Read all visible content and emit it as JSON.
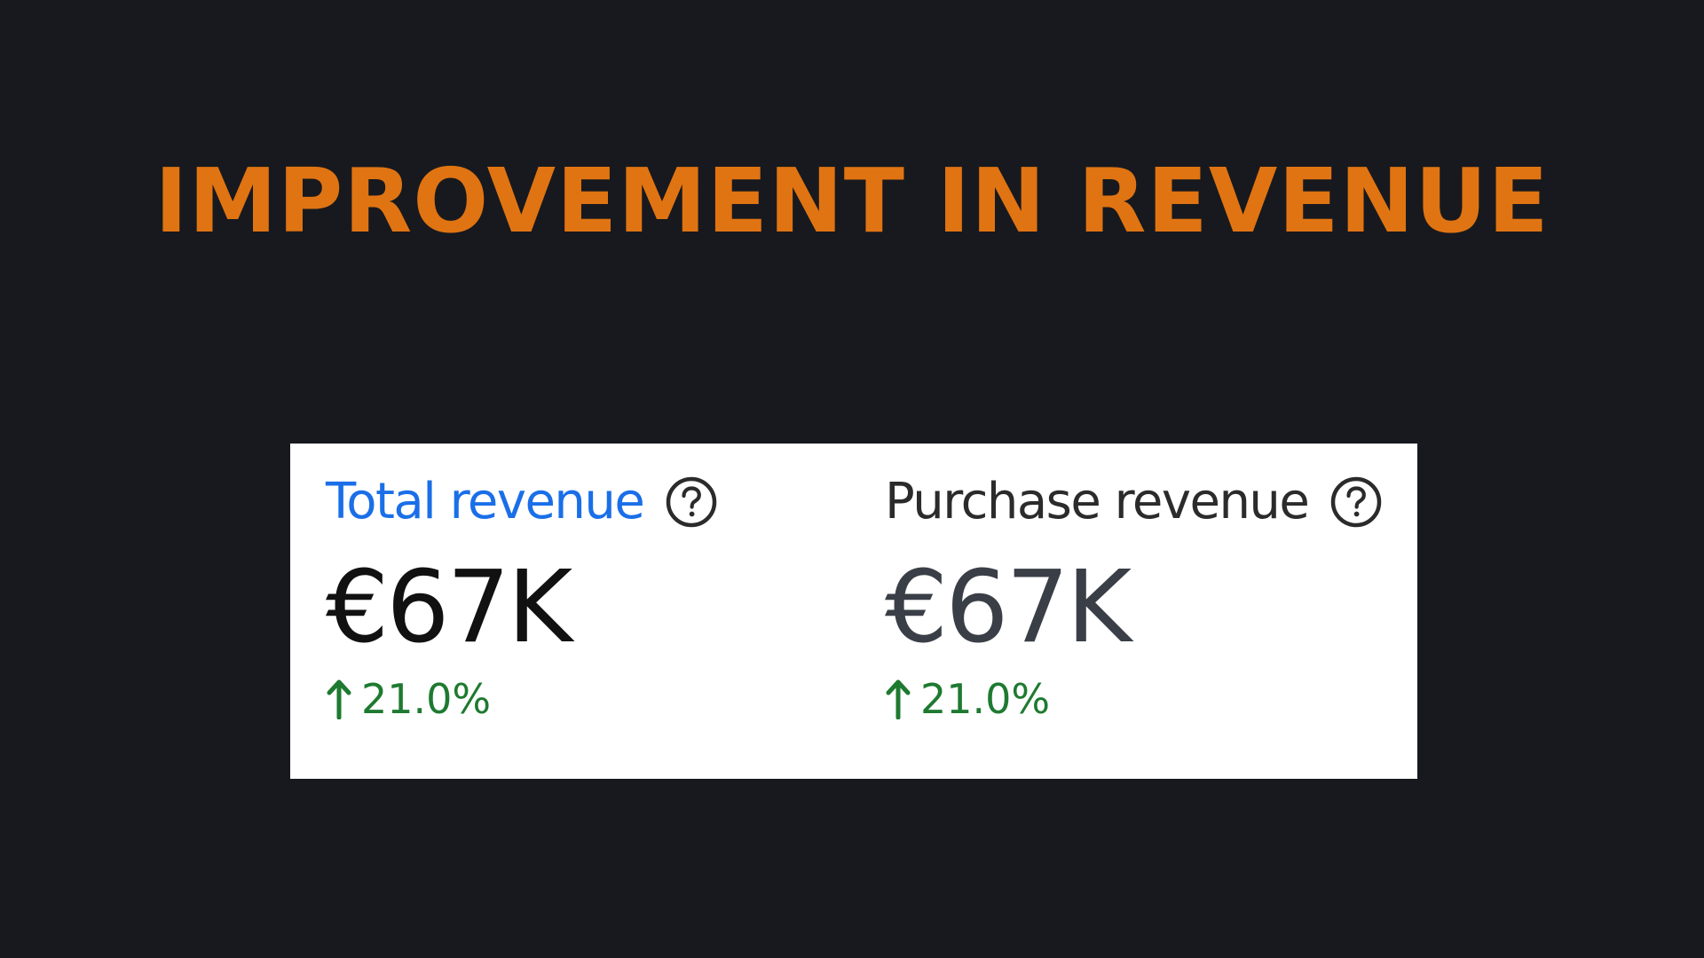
{
  "headline": {
    "text": "IMPROVEMENT IN REVENUE",
    "color": "#e07412"
  },
  "metrics": [
    {
      "label": "Total revenue",
      "label_color": "#1a6fe8",
      "help_icon": "question-circle-icon",
      "value": "€67K",
      "value_color": "#111111",
      "change_icon": "arrow-up-icon",
      "change": "21.0%",
      "change_color": "#1e7a30"
    },
    {
      "label": "Purchase revenue",
      "label_color": "#2b2b2b",
      "help_icon": "question-circle-icon",
      "value": "€67K",
      "value_color": "#3a3f47",
      "change_icon": "arrow-up-icon",
      "change": "21.0%",
      "change_color": "#1e7a30"
    }
  ],
  "colors": {
    "background": "#18191e",
    "card": "#ffffff",
    "icon": "#2b2b2b"
  }
}
